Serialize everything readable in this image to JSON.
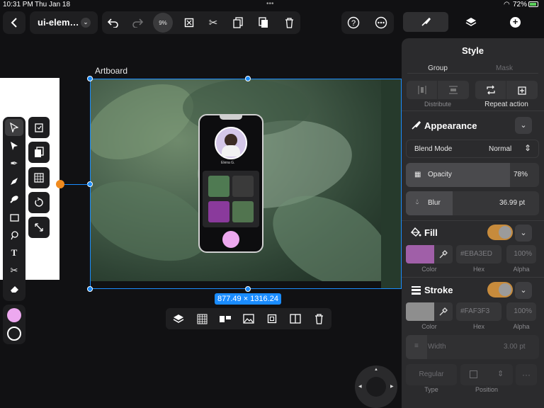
{
  "status": {
    "time": "10:31 PM",
    "date": "Thu Jan 18",
    "battery": "72%"
  },
  "toolbar": {
    "doc_name": "ui-elem…",
    "zoom": "9%",
    "icons": [
      "back-icon",
      "undo-icon",
      "redo-icon",
      "zoom-dial",
      "crop-icon",
      "scissors-icon",
      "copy-icon",
      "paste-icon",
      "trash-icon",
      "help-icon",
      "more-icon"
    ]
  },
  "panel_tabs": [
    "brush-tab",
    "layers-tab",
    "add-tab"
  ],
  "canvas": {
    "artboard_label": "Artboard",
    "dimensions": "877.49 × 1316.24",
    "profile_name": "Elena G."
  },
  "style_panel": {
    "title": "Style",
    "group": "Group",
    "mask": "Mask",
    "distribute": "Distribute",
    "repeat_action": "Repeat action",
    "appearance": {
      "title": "Appearance",
      "blend_mode_label": "Blend Mode",
      "blend_mode_value": "Normal",
      "opacity_label": "Opacity",
      "opacity_value": "78%",
      "opacity_level": 0.78,
      "blur_label": "Blur",
      "blur_value": "36.99 pt"
    },
    "fill": {
      "title": "Fill",
      "enabled": true,
      "color": "#A05FA8",
      "hex": "#EBA3ED",
      "alpha": "100%",
      "color_label": "Color",
      "hex_label": "Hex",
      "alpha_label": "Alpha"
    },
    "stroke": {
      "title": "Stroke",
      "enabled": true,
      "color": "#8E8E8E",
      "hex": "#FAF3F3",
      "alpha": "100%",
      "color_label": "Color",
      "hex_label": "Hex",
      "alpha_label": "Alpha",
      "width_label": "Width",
      "width_value": "3.00 pt",
      "type_value": "Regular",
      "type_label": "Type",
      "position_label": "Position"
    }
  },
  "left_tools": [
    "select-tool",
    "direct-select-tool",
    "pen-tool",
    "vector-brush-tool",
    "brush-tool",
    "rectangle-tool",
    "lasso-tool",
    "text-tool",
    "scissors-tool",
    "eraser-tool"
  ],
  "colors": {
    "fill_swatch": "#EDA8EF",
    "accent": "#1A8CFF",
    "toggle": "#C78B3C"
  }
}
